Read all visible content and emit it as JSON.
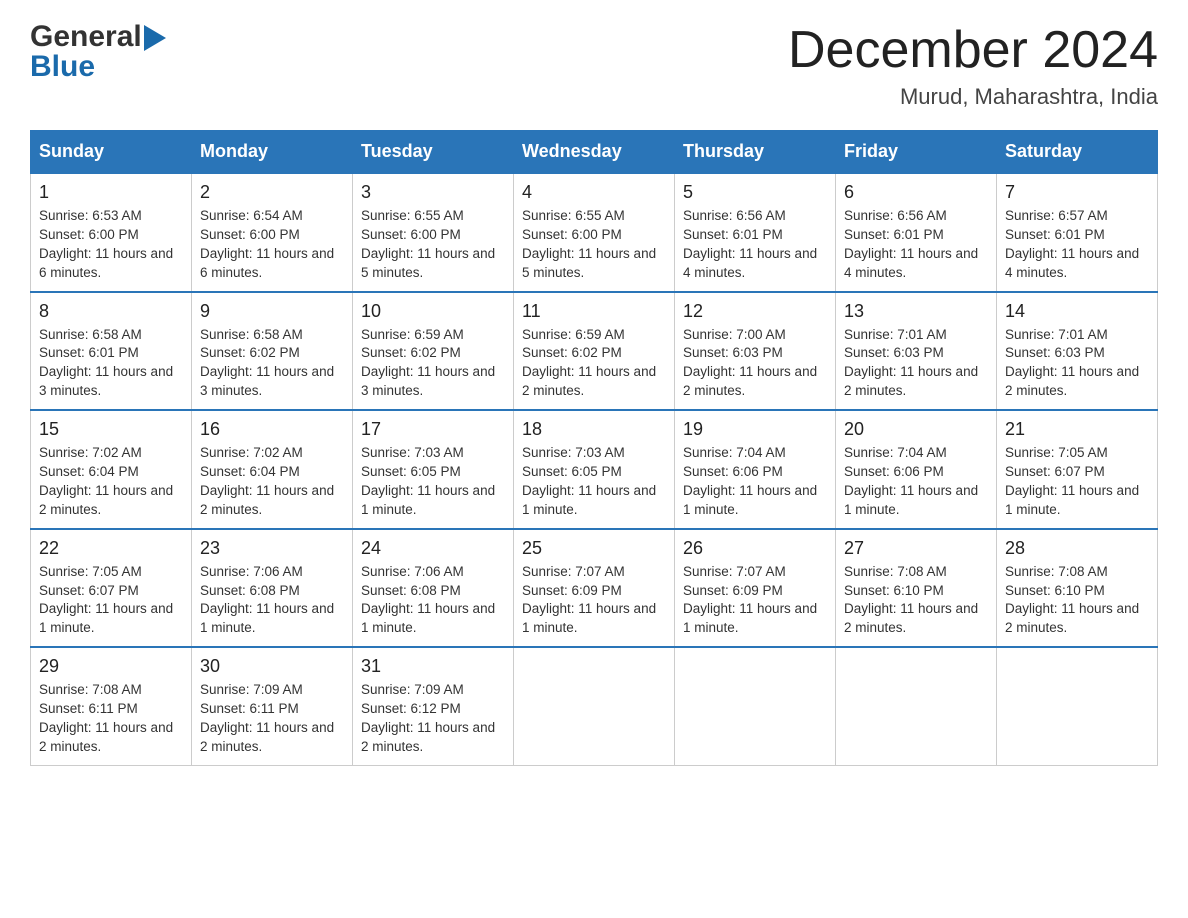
{
  "header": {
    "logo": {
      "general": "General",
      "blue": "Blue",
      "icon": "▶"
    },
    "title": "December 2024",
    "location": "Murud, Maharashtra, India"
  },
  "columns": [
    "Sunday",
    "Monday",
    "Tuesday",
    "Wednesday",
    "Thursday",
    "Friday",
    "Saturday"
  ],
  "weeks": [
    [
      {
        "day": "1",
        "sunrise": "6:53 AM",
        "sunset": "6:00 PM",
        "daylight": "11 hours and 6 minutes."
      },
      {
        "day": "2",
        "sunrise": "6:54 AM",
        "sunset": "6:00 PM",
        "daylight": "11 hours and 6 minutes."
      },
      {
        "day": "3",
        "sunrise": "6:55 AM",
        "sunset": "6:00 PM",
        "daylight": "11 hours and 5 minutes."
      },
      {
        "day": "4",
        "sunrise": "6:55 AM",
        "sunset": "6:00 PM",
        "daylight": "11 hours and 5 minutes."
      },
      {
        "day": "5",
        "sunrise": "6:56 AM",
        "sunset": "6:01 PM",
        "daylight": "11 hours and 4 minutes."
      },
      {
        "day": "6",
        "sunrise": "6:56 AM",
        "sunset": "6:01 PM",
        "daylight": "11 hours and 4 minutes."
      },
      {
        "day": "7",
        "sunrise": "6:57 AM",
        "sunset": "6:01 PM",
        "daylight": "11 hours and 4 minutes."
      }
    ],
    [
      {
        "day": "8",
        "sunrise": "6:58 AM",
        "sunset": "6:01 PM",
        "daylight": "11 hours and 3 minutes."
      },
      {
        "day": "9",
        "sunrise": "6:58 AM",
        "sunset": "6:02 PM",
        "daylight": "11 hours and 3 minutes."
      },
      {
        "day": "10",
        "sunrise": "6:59 AM",
        "sunset": "6:02 PM",
        "daylight": "11 hours and 3 minutes."
      },
      {
        "day": "11",
        "sunrise": "6:59 AM",
        "sunset": "6:02 PM",
        "daylight": "11 hours and 2 minutes."
      },
      {
        "day": "12",
        "sunrise": "7:00 AM",
        "sunset": "6:03 PM",
        "daylight": "11 hours and 2 minutes."
      },
      {
        "day": "13",
        "sunrise": "7:01 AM",
        "sunset": "6:03 PM",
        "daylight": "11 hours and 2 minutes."
      },
      {
        "day": "14",
        "sunrise": "7:01 AM",
        "sunset": "6:03 PM",
        "daylight": "11 hours and 2 minutes."
      }
    ],
    [
      {
        "day": "15",
        "sunrise": "7:02 AM",
        "sunset": "6:04 PM",
        "daylight": "11 hours and 2 minutes."
      },
      {
        "day": "16",
        "sunrise": "7:02 AM",
        "sunset": "6:04 PM",
        "daylight": "11 hours and 2 minutes."
      },
      {
        "day": "17",
        "sunrise": "7:03 AM",
        "sunset": "6:05 PM",
        "daylight": "11 hours and 1 minute."
      },
      {
        "day": "18",
        "sunrise": "7:03 AM",
        "sunset": "6:05 PM",
        "daylight": "11 hours and 1 minute."
      },
      {
        "day": "19",
        "sunrise": "7:04 AM",
        "sunset": "6:06 PM",
        "daylight": "11 hours and 1 minute."
      },
      {
        "day": "20",
        "sunrise": "7:04 AM",
        "sunset": "6:06 PM",
        "daylight": "11 hours and 1 minute."
      },
      {
        "day": "21",
        "sunrise": "7:05 AM",
        "sunset": "6:07 PM",
        "daylight": "11 hours and 1 minute."
      }
    ],
    [
      {
        "day": "22",
        "sunrise": "7:05 AM",
        "sunset": "6:07 PM",
        "daylight": "11 hours and 1 minute."
      },
      {
        "day": "23",
        "sunrise": "7:06 AM",
        "sunset": "6:08 PM",
        "daylight": "11 hours and 1 minute."
      },
      {
        "day": "24",
        "sunrise": "7:06 AM",
        "sunset": "6:08 PM",
        "daylight": "11 hours and 1 minute."
      },
      {
        "day": "25",
        "sunrise": "7:07 AM",
        "sunset": "6:09 PM",
        "daylight": "11 hours and 1 minute."
      },
      {
        "day": "26",
        "sunrise": "7:07 AM",
        "sunset": "6:09 PM",
        "daylight": "11 hours and 1 minute."
      },
      {
        "day": "27",
        "sunrise": "7:08 AM",
        "sunset": "6:10 PM",
        "daylight": "11 hours and 2 minutes."
      },
      {
        "day": "28",
        "sunrise": "7:08 AM",
        "sunset": "6:10 PM",
        "daylight": "11 hours and 2 minutes."
      }
    ],
    [
      {
        "day": "29",
        "sunrise": "7:08 AM",
        "sunset": "6:11 PM",
        "daylight": "11 hours and 2 minutes."
      },
      {
        "day": "30",
        "sunrise": "7:09 AM",
        "sunset": "6:11 PM",
        "daylight": "11 hours and 2 minutes."
      },
      {
        "day": "31",
        "sunrise": "7:09 AM",
        "sunset": "6:12 PM",
        "daylight": "11 hours and 2 minutes."
      },
      null,
      null,
      null,
      null
    ]
  ]
}
